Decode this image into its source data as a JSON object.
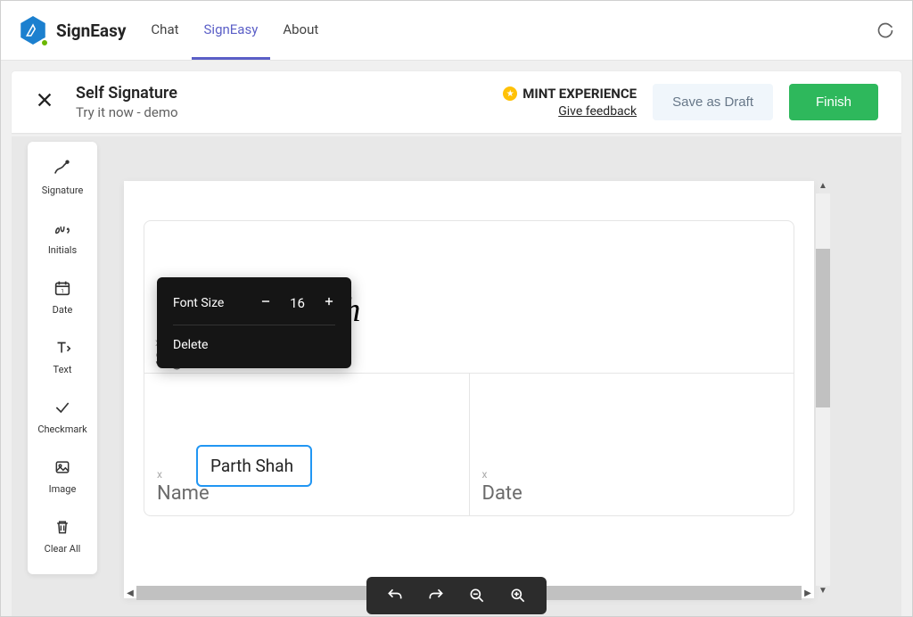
{
  "header": {
    "brand": "SignEasy",
    "tabs": [
      {
        "label": "Chat",
        "active": false
      },
      {
        "label": "SignEasy",
        "active": true
      },
      {
        "label": "About",
        "active": false
      }
    ]
  },
  "subheader": {
    "title": "Self Signature",
    "subtitle": "Try it now - demo",
    "mint_label": "MINT EXPERIENCE",
    "feedback_link": "Give feedback",
    "draft_button": "Save as Draft",
    "finish_button": "Finish"
  },
  "sidebar": {
    "items": [
      {
        "label": "Signature"
      },
      {
        "label": "Initials"
      },
      {
        "label": "Date"
      },
      {
        "label": "Text"
      },
      {
        "label": "Checkmark"
      },
      {
        "label": "Image"
      },
      {
        "label": "Clear All"
      }
    ]
  },
  "document": {
    "signature_x": "x",
    "signature_label": "Signature",
    "signature_value": "parth",
    "name_x": "x",
    "name_label": "Name",
    "name_value": "Parth Shah",
    "date_x": "x",
    "date_label": "Date"
  },
  "popup": {
    "font_size_label": "Font Size",
    "font_size_value": "16",
    "delete_label": "Delete"
  }
}
